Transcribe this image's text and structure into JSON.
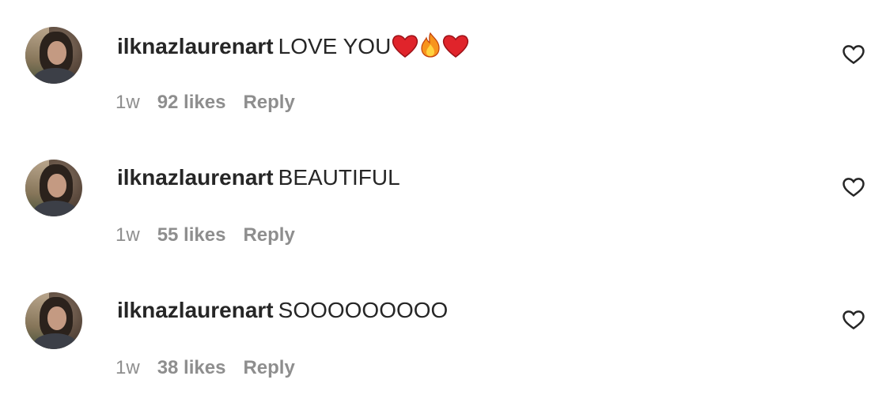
{
  "comments": [
    {
      "username": "ilknazlaurenart",
      "text": "LOVE YOU",
      "emojis": [
        "red-heart",
        "fire",
        "red-heart"
      ],
      "time": "1w",
      "likes": "92 likes",
      "reply_label": "Reply"
    },
    {
      "username": "ilknazlaurenart",
      "text": "BEAUTIFUL",
      "emojis": [],
      "time": "1w",
      "likes": "55 likes",
      "reply_label": "Reply"
    },
    {
      "username": "ilknazlaurenart",
      "text": "SOOOOOOOOO",
      "emojis": [],
      "time": "1w",
      "likes": "38 likes",
      "reply_label": "Reply"
    }
  ],
  "icons": {
    "like": "heart-outline-icon",
    "avatar": "profile-photo"
  },
  "colors": {
    "text": "#262626",
    "meta": "#8e8e8e",
    "heart_emoji": "#e0242b",
    "fire_emoji": "#f7941d"
  }
}
